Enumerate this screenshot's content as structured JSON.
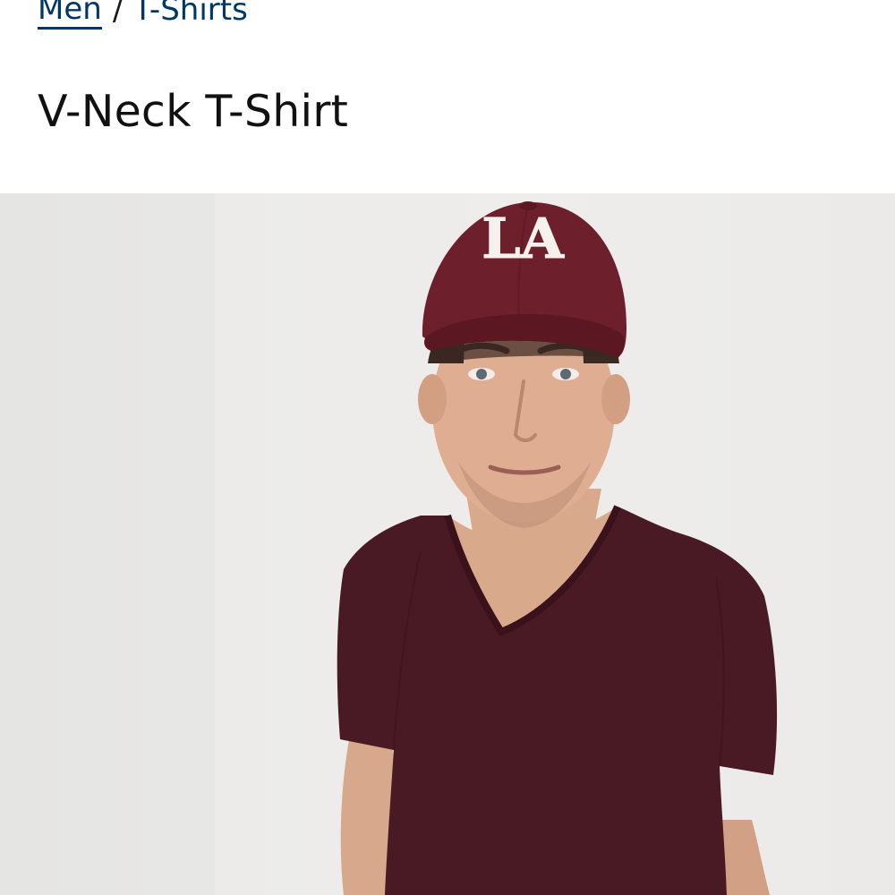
{
  "breadcrumb": {
    "items": [
      {
        "label": "Men"
      },
      {
        "label": "T-Shirts"
      }
    ],
    "separator": "/"
  },
  "product": {
    "title": "V-Neck T-Shirt",
    "image": {
      "subject": "model wearing maroon v-neck t-shirt and maroon LA cap",
      "shirt_color": "#4a1a24",
      "cap_color": "#6e1f2c",
      "cap_logo_text": "LA"
    }
  },
  "colors": {
    "link": "#003764",
    "title": "#111111",
    "background": "#ffffff"
  }
}
